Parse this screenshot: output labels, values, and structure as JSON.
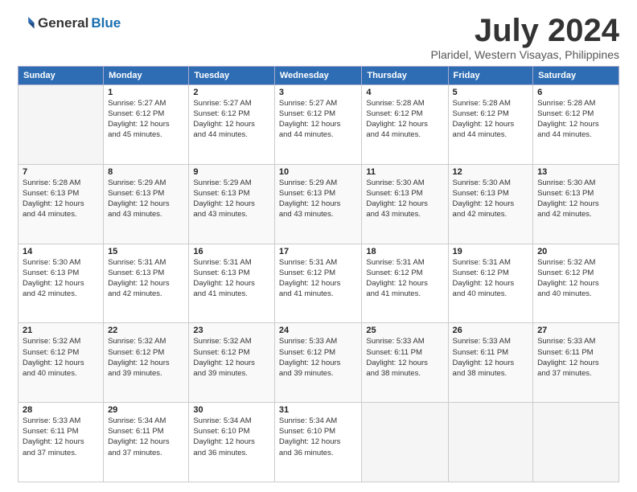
{
  "header": {
    "logo_general": "General",
    "logo_blue": "Blue",
    "month": "July 2024",
    "location": "Plaridel, Western Visayas, Philippines"
  },
  "weekdays": [
    "Sunday",
    "Monday",
    "Tuesday",
    "Wednesday",
    "Thursday",
    "Friday",
    "Saturday"
  ],
  "weeks": [
    [
      {
        "day": "",
        "info": ""
      },
      {
        "day": "1",
        "info": "Sunrise: 5:27 AM\nSunset: 6:12 PM\nDaylight: 12 hours\nand 45 minutes."
      },
      {
        "day": "2",
        "info": "Sunrise: 5:27 AM\nSunset: 6:12 PM\nDaylight: 12 hours\nand 44 minutes."
      },
      {
        "day": "3",
        "info": "Sunrise: 5:27 AM\nSunset: 6:12 PM\nDaylight: 12 hours\nand 44 minutes."
      },
      {
        "day": "4",
        "info": "Sunrise: 5:28 AM\nSunset: 6:12 PM\nDaylight: 12 hours\nand 44 minutes."
      },
      {
        "day": "5",
        "info": "Sunrise: 5:28 AM\nSunset: 6:12 PM\nDaylight: 12 hours\nand 44 minutes."
      },
      {
        "day": "6",
        "info": "Sunrise: 5:28 AM\nSunset: 6:12 PM\nDaylight: 12 hours\nand 44 minutes."
      }
    ],
    [
      {
        "day": "7",
        "info": "Sunrise: 5:28 AM\nSunset: 6:13 PM\nDaylight: 12 hours\nand 44 minutes."
      },
      {
        "day": "8",
        "info": "Sunrise: 5:29 AM\nSunset: 6:13 PM\nDaylight: 12 hours\nand 43 minutes."
      },
      {
        "day": "9",
        "info": "Sunrise: 5:29 AM\nSunset: 6:13 PM\nDaylight: 12 hours\nand 43 minutes."
      },
      {
        "day": "10",
        "info": "Sunrise: 5:29 AM\nSunset: 6:13 PM\nDaylight: 12 hours\nand 43 minutes."
      },
      {
        "day": "11",
        "info": "Sunrise: 5:30 AM\nSunset: 6:13 PM\nDaylight: 12 hours\nand 43 minutes."
      },
      {
        "day": "12",
        "info": "Sunrise: 5:30 AM\nSunset: 6:13 PM\nDaylight: 12 hours\nand 42 minutes."
      },
      {
        "day": "13",
        "info": "Sunrise: 5:30 AM\nSunset: 6:13 PM\nDaylight: 12 hours\nand 42 minutes."
      }
    ],
    [
      {
        "day": "14",
        "info": "Sunrise: 5:30 AM\nSunset: 6:13 PM\nDaylight: 12 hours\nand 42 minutes."
      },
      {
        "day": "15",
        "info": "Sunrise: 5:31 AM\nSunset: 6:13 PM\nDaylight: 12 hours\nand 42 minutes."
      },
      {
        "day": "16",
        "info": "Sunrise: 5:31 AM\nSunset: 6:13 PM\nDaylight: 12 hours\nand 41 minutes."
      },
      {
        "day": "17",
        "info": "Sunrise: 5:31 AM\nSunset: 6:12 PM\nDaylight: 12 hours\nand 41 minutes."
      },
      {
        "day": "18",
        "info": "Sunrise: 5:31 AM\nSunset: 6:12 PM\nDaylight: 12 hours\nand 41 minutes."
      },
      {
        "day": "19",
        "info": "Sunrise: 5:31 AM\nSunset: 6:12 PM\nDaylight: 12 hours\nand 40 minutes."
      },
      {
        "day": "20",
        "info": "Sunrise: 5:32 AM\nSunset: 6:12 PM\nDaylight: 12 hours\nand 40 minutes."
      }
    ],
    [
      {
        "day": "21",
        "info": "Sunrise: 5:32 AM\nSunset: 6:12 PM\nDaylight: 12 hours\nand 40 minutes."
      },
      {
        "day": "22",
        "info": "Sunrise: 5:32 AM\nSunset: 6:12 PM\nDaylight: 12 hours\nand 39 minutes."
      },
      {
        "day": "23",
        "info": "Sunrise: 5:32 AM\nSunset: 6:12 PM\nDaylight: 12 hours\nand 39 minutes."
      },
      {
        "day": "24",
        "info": "Sunrise: 5:33 AM\nSunset: 6:12 PM\nDaylight: 12 hours\nand 39 minutes."
      },
      {
        "day": "25",
        "info": "Sunrise: 5:33 AM\nSunset: 6:11 PM\nDaylight: 12 hours\nand 38 minutes."
      },
      {
        "day": "26",
        "info": "Sunrise: 5:33 AM\nSunset: 6:11 PM\nDaylight: 12 hours\nand 38 minutes."
      },
      {
        "day": "27",
        "info": "Sunrise: 5:33 AM\nSunset: 6:11 PM\nDaylight: 12 hours\nand 37 minutes."
      }
    ],
    [
      {
        "day": "28",
        "info": "Sunrise: 5:33 AM\nSunset: 6:11 PM\nDaylight: 12 hours\nand 37 minutes."
      },
      {
        "day": "29",
        "info": "Sunrise: 5:34 AM\nSunset: 6:11 PM\nDaylight: 12 hours\nand 37 minutes."
      },
      {
        "day": "30",
        "info": "Sunrise: 5:34 AM\nSunset: 6:10 PM\nDaylight: 12 hours\nand 36 minutes."
      },
      {
        "day": "31",
        "info": "Sunrise: 5:34 AM\nSunset: 6:10 PM\nDaylight: 12 hours\nand 36 minutes."
      },
      {
        "day": "",
        "info": ""
      },
      {
        "day": "",
        "info": ""
      },
      {
        "day": "",
        "info": ""
      }
    ]
  ]
}
